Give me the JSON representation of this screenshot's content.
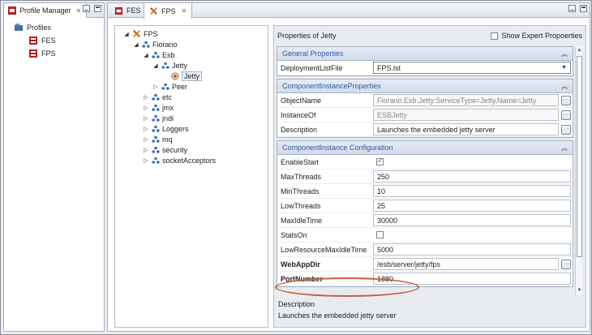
{
  "left_panel": {
    "tab_title": "Profile Manager",
    "root_label": "Profiles",
    "items": [
      {
        "label": "FES"
      },
      {
        "label": "FPS"
      }
    ]
  },
  "editor": {
    "tabs": [
      {
        "label": "FES"
      },
      {
        "label": "FPS"
      }
    ]
  },
  "tree": {
    "root": "FPS",
    "fiorano": "Fiorano",
    "esb": "Esb",
    "jetty_folder": "Jetty",
    "jetty_selected": "Jetty",
    "peer": "Peer",
    "others": [
      "etc",
      "jmx",
      "jndi",
      "Loggers",
      "mq",
      "security",
      "socketAcceptors"
    ]
  },
  "properties": {
    "title": "Properties of Jetty",
    "expert_label": "Show Expert Propoerties",
    "sections": [
      {
        "title": "General Properties",
        "rows": [
          {
            "label": "DeploymentListFile",
            "value": "FPS.lst"
          }
        ]
      },
      {
        "title": "ComponentInstanceProperties",
        "rows": [
          {
            "label": "ObjectName",
            "value": "Fiorano.Esb.Jetty:ServiceType=Jetty,Name=Jetty"
          },
          {
            "label": "InstanceOf",
            "value": "ESBJetty"
          },
          {
            "label": "Description",
            "value": "Launches the embedded jetty server"
          }
        ]
      },
      {
        "title": "ComponentInstance Configuration",
        "rows": [
          {
            "label": "EnableStart",
            "checked": true
          },
          {
            "label": "MaxThreads",
            "value": "250"
          },
          {
            "label": "MinThreads",
            "value": "10"
          },
          {
            "label": "LowThreads",
            "value": "25"
          },
          {
            "label": "MaxIdleTime",
            "value": "30000"
          },
          {
            "label": "StatsOn",
            "checked": false
          },
          {
            "label": "LowResourceMaxIdleTime",
            "value": "5000"
          },
          {
            "label": "WebAppDir",
            "value": "/esb/server/jetty/fps"
          },
          {
            "label": "PortNumber",
            "value": "1880"
          }
        ]
      }
    ],
    "description_title": "Description",
    "description_text": "Launches the embedded jetty server"
  },
  "colors": {
    "section_header_text": "#2f5aa6",
    "highlight_oval": "#c2613a",
    "checkbox_tick": "#2a56a8"
  },
  "icons": [
    "profile-manager-icon",
    "server-profile-icon",
    "fps-tools-icon",
    "node-icon",
    "jetty-component-icon",
    "ellipsis-icon"
  ]
}
